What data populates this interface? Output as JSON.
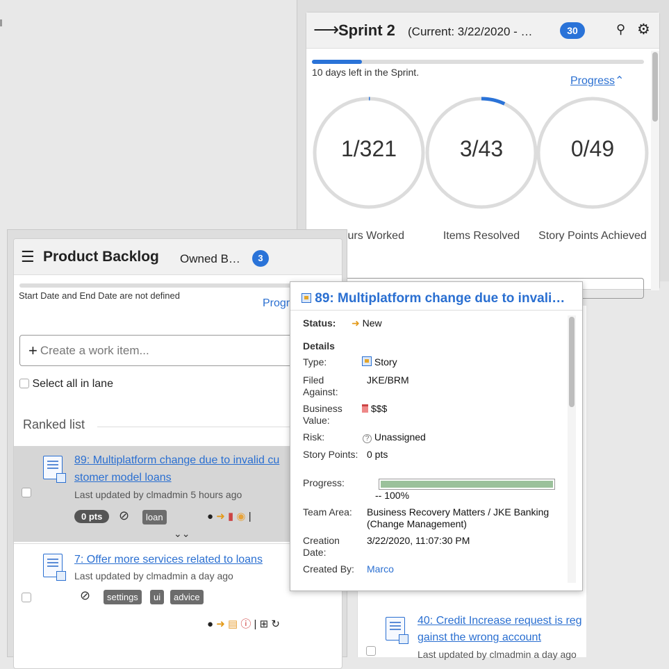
{
  "sprint": {
    "title": "Sprint 2",
    "subtitle": "(Current: 3/22/2020 - …",
    "count": "30",
    "days_left": "10 days left in the Sprint.",
    "progress_link": "Progress",
    "progress_fraction": 0.15,
    "gauges": [
      {
        "value": "1/321",
        "label": "Hours Worked",
        "fraction": 0.003
      },
      {
        "value": "3/43",
        "label": "Items Resolved",
        "fraction": 0.07
      },
      {
        "value": "0/49",
        "label": "Story Points Achieved",
        "fraction": 0
      }
    ]
  },
  "backlog": {
    "title": "Product Backlog",
    "subtitle": "Owned B…",
    "count": "3",
    "dates_note": "Start Date and End Date are not defined",
    "progress_link": "Progr",
    "create_placeholder": "Create a work item...",
    "select_all": "Select all in lane",
    "ranked_list": "Ranked list",
    "items": [
      {
        "title_line1": "89: Multiplatform change due to invalid cu",
        "title_line2": "stomer model loans",
        "meta": "Last updated by clmadmin 5 hours ago",
        "points": "0 pts",
        "tags": [
          "loan"
        ]
      },
      {
        "title_line1": "7: Offer more services related to loans",
        "meta": "Last updated by clmadmin a day ago",
        "tags": [
          "settings",
          "ui",
          "advice"
        ]
      }
    ],
    "item40": {
      "title_line1": "40: Credit Increase request is reg",
      "title_line2": "gainst the wrong account",
      "meta": "Last updated by clmadmin a day ago"
    }
  },
  "popup": {
    "title": "89: Multiplatform change due to invali…",
    "status_label": "Status:",
    "status_value": "New",
    "details_heading": "Details",
    "type_label": "Type:",
    "type_value": "Story",
    "filed_label": "Filed Against:",
    "filed_value": "JKE/BRM",
    "bv_label": "Business Value:",
    "bv_value": "$$$",
    "risk_label": "Risk:",
    "risk_value": "Unassigned",
    "sp_label": "Story Points:",
    "sp_value": "0 pts",
    "progress_label": "Progress:",
    "progress_value": "-- 100%",
    "progress_fraction": 1.0,
    "team_label": "Team Area:",
    "team_value": "Business Recovery Matters / JKE Banking (Change Management)",
    "creation_label": "Creation Date:",
    "creation_value": "3/22/2020, 11:07:30 PM",
    "created_by_label": "Created By:",
    "created_by_value": "Marco"
  },
  "icons": {
    "sprint": "arrow-right-icon",
    "backlog": "list-icon",
    "pin": "pin-icon",
    "settings": "gear-icon"
  },
  "colors": {
    "accent": "#2a73d8",
    "link": "#2a6fd1"
  }
}
